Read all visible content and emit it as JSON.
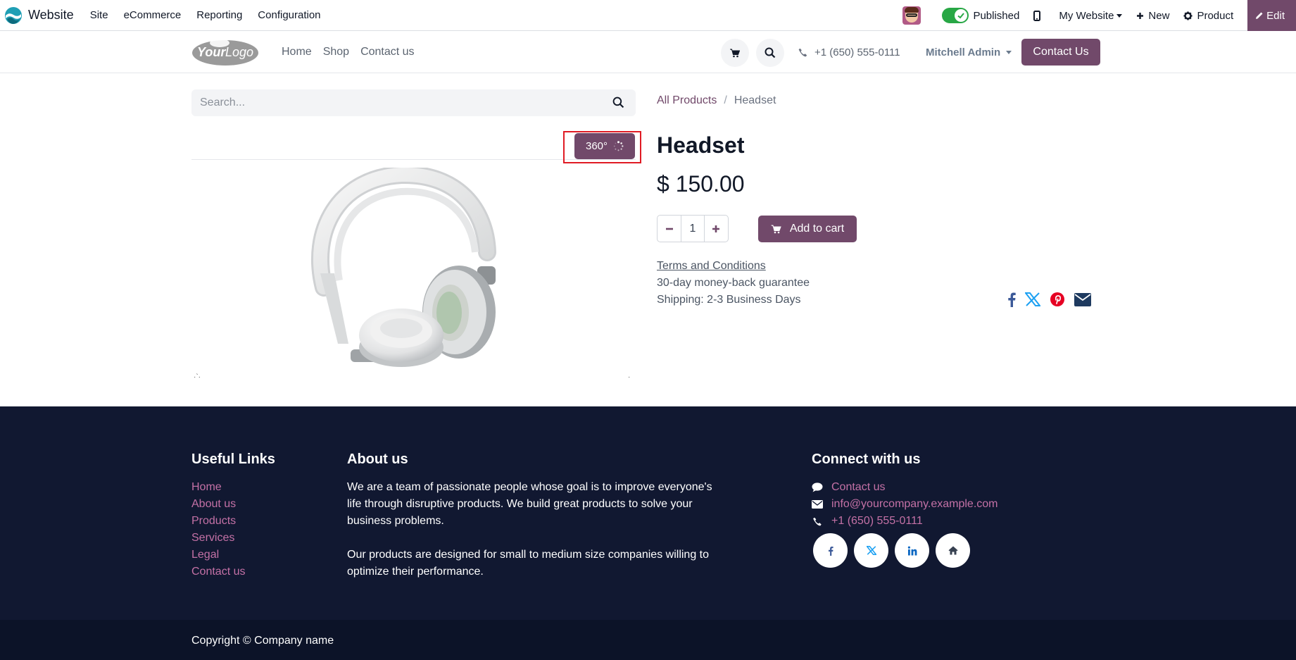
{
  "topbar": {
    "app_name": "Website",
    "menu": [
      "Site",
      "eCommerce",
      "Reporting",
      "Configuration"
    ],
    "published_label": "Published",
    "published": true,
    "website_label": "My Website",
    "new_label": "New",
    "product_label": "Product",
    "edit_label": "Edit"
  },
  "header": {
    "nav": [
      "Home",
      "Shop",
      "Contact us"
    ],
    "phone": "+1 (650) 555-0111",
    "user": "Mitchell Admin",
    "contact_button": "Contact Us"
  },
  "product": {
    "search_placeholder": "Search...",
    "badge_360": "360°",
    "breadcrumb": {
      "parent": "All Products",
      "current": "Headset"
    },
    "title": "Headset",
    "price": "$ 150.00",
    "quantity": "1",
    "add_to_cart": "Add to cart",
    "terms": "Terms and Conditions",
    "guarantee": "30-day money-back guarantee",
    "shipping": "Shipping: 2-3 Business Days"
  },
  "footer": {
    "useful_links_title": "Useful Links",
    "useful_links": [
      "Home",
      "About us",
      "Products",
      "Services",
      "Legal",
      "Contact us"
    ],
    "about_title": "About us",
    "about_p1": "We are a team of passionate people whose goal is to improve everyone's life through disruptive products. We build great products to solve your business problems.",
    "about_p2": "Our products are designed for small to medium size companies willing to optimize their performance.",
    "connect_title": "Connect with us",
    "connect": {
      "contact": "Contact us",
      "email": "info@yourcompany.example.com",
      "phone": "+1 (650) 555-0111"
    },
    "socials": [
      "facebook-icon",
      "x-icon",
      "linkedin-icon",
      "home-icon"
    ],
    "copyright": "Copyright © Company name"
  },
  "colors": {
    "brand": "#71496a",
    "footer_bg": "#111831",
    "link_pink": "#c471a6",
    "highlight": "#e01b24"
  }
}
